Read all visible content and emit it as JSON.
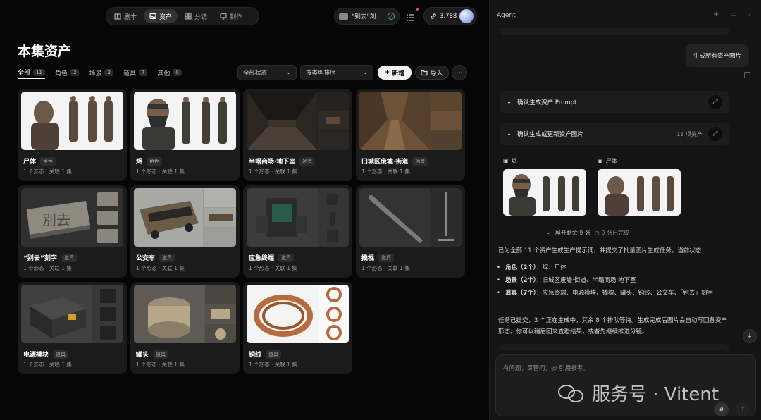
{
  "nav": {
    "tabs": [
      {
        "label": "剧本",
        "icon": "book-icon"
      },
      {
        "label": "资产",
        "icon": "image-icon",
        "active": true
      },
      {
        "label": "分镜",
        "icon": "grid-icon"
      },
      {
        "label": "制作",
        "icon": "monitor-icon"
      }
    ]
  },
  "project": {
    "name": "“别去”刻..."
  },
  "credits": {
    "value": "3,788"
  },
  "page": {
    "title": "本集资产"
  },
  "filters": [
    {
      "label": "全部",
      "count": "11"
    },
    {
      "label": "角色",
      "count": "2"
    },
    {
      "label": "场景",
      "count": "2"
    },
    {
      "label": "道具",
      "count": "7"
    },
    {
      "label": "其他",
      "count": "0"
    }
  ],
  "controls": {
    "status": "全部状态",
    "sort": "按类型排序",
    "new": "新增",
    "import": "导入"
  },
  "assets": [
    {
      "name": "尸体",
      "tag": "角色",
      "meta": "1 个形态 · 关联 1 集"
    },
    {
      "name": "烬",
      "tag": "角色",
      "meta": "1 个形态 · 关联 1 集"
    },
    {
      "name": "半塌商场·地下室",
      "tag": "场景",
      "meta": "1 个形态 · 关联 1 集"
    },
    {
      "name": "旧城区废墟·街道",
      "tag": "场景",
      "meta": "1 个形态 · 关联 1 集"
    },
    {
      "name": "“别去”刻字",
      "tag": "道具",
      "meta": "1 个形态 · 关联 1 集"
    },
    {
      "name": "公交车",
      "tag": "道具",
      "meta": "1 个形态 · 关联 1 集"
    },
    {
      "name": "应急终端",
      "tag": "道具",
      "meta": "1 个形态 · 关联 1 集"
    },
    {
      "name": "撬棍",
      "tag": "道具",
      "meta": "1 个形态 · 关联 1 集"
    },
    {
      "name": "电源模块",
      "tag": "道具",
      "meta": "1 个形态 · 关联 1 集"
    },
    {
      "name": "罐头",
      "tag": "道具",
      "meta": "1 个形态 · 关联 1 集"
    },
    {
      "name": "铜线",
      "tag": "道具",
      "meta": "1 个形态 · 关联 1 集"
    }
  ],
  "agent": {
    "title": "Agent",
    "user_msg": "生成所有资产图片",
    "acc1": "确认生成资产 Prompt",
    "acc2": "确认生成或更新资产图片",
    "acc2_count": "11 项资产",
    "thumb1": "烬",
    "thumb2": "尸体",
    "show_more": "展开剩余 9 张",
    "done": "9 张已完成",
    "p1": "已为全部 11 个资产生成生产提示词，并提交了批量图片生成任务。当前状态：",
    "b1_label": "角色（2个）",
    "b1_text": "：烬、尸体",
    "b2_label": "场景（2个）",
    "b2_text": "：旧城区废墟·街道、半塌商场·地下室",
    "b3_label": "道具（7个）",
    "b3_text": "：应急终端、电源模块、撬棍、罐头、铜线、公交车、「别去」刻字",
    "p2": "任务已提交，3 个正在生成中，其余 8 个排队等待。生成完成后图片会自动写回各资产形态。你可以稍后回来查看结果，或者先继续推进分镜。",
    "input_placeholder": "有问题，尽管问，@ 引用参考。"
  },
  "watermark": "服务号 · Vitent"
}
